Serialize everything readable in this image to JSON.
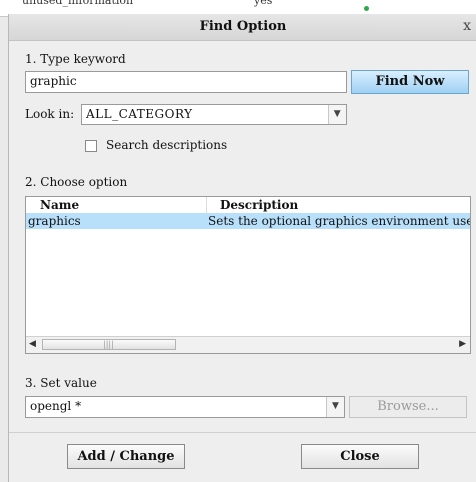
{
  "background": {
    "col1_text": "unused_information",
    "col2_text": "yes"
  },
  "dialog": {
    "title": "Find Option",
    "close_glyph": "x"
  },
  "step1": {
    "label": "1.  Type keyword",
    "keyword_value": "graphic",
    "find_button": "Find Now"
  },
  "look_in": {
    "label": "Look in:",
    "value": "ALL_CATEGORY"
  },
  "search_descriptions": {
    "label": "Search descriptions",
    "checked": false
  },
  "step2": {
    "label": "2.  Choose option",
    "columns": [
      "Name",
      "Description"
    ],
    "rows": [
      {
        "name": "graphics",
        "description": "Sets the optional graphics environment used b",
        "selected": true
      }
    ]
  },
  "step3": {
    "label": "3.  Set value",
    "value": "opengl *",
    "browse_button": "Browse..."
  },
  "footer": {
    "add_change_button": "Add / Change",
    "close_button": "Close"
  },
  "colors": {
    "selected_row": "#b9e0fb",
    "primary_button": "#9fd0f3"
  }
}
